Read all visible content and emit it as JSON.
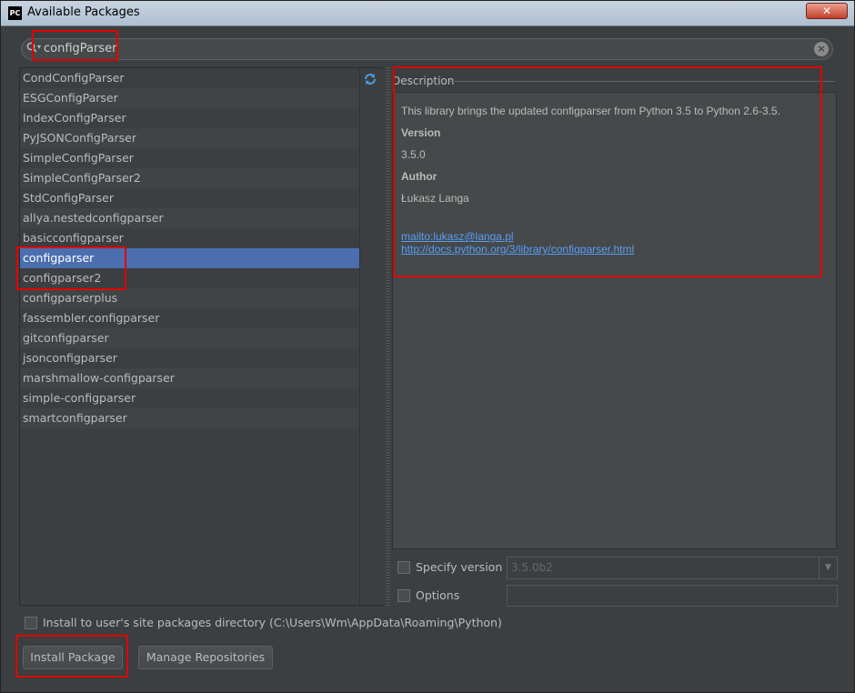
{
  "window": {
    "title": "Available Packages",
    "app_icon_text": "PC",
    "close_glyph": "✕"
  },
  "search": {
    "value": "configParser",
    "icon": "search-icon",
    "clear_glyph": "×"
  },
  "packages": [
    "CondConfigParser",
    "ESGConfigParser",
    "IndexConfigParser",
    "PyJSONConfigParser",
    "SimpleConfigParser",
    "SimpleConfigParser2",
    "StdConfigParser",
    "allya.nestedconfigparser",
    "basicconfigparser",
    "configparser",
    "configparser2",
    "configparserplus",
    "fassembler.configparser",
    "gitconfigparser",
    "jsonconfigparser",
    "marshmallow-configparser",
    "simple-configparser",
    "smartconfigparser"
  ],
  "selected_package": "configparser",
  "description": {
    "label": "Description",
    "summary": "This library brings the updated configparser from Python 3.5 to Python 2.6-3.5.",
    "version_heading": "Version",
    "version": "3.5.0",
    "author_heading": "Author",
    "author": "Łukasz Langa",
    "links": [
      "mailto:lukasz@langa.pl",
      "http://docs.python.org/3/library/configparser.html"
    ]
  },
  "options": {
    "specify_version_label": "Specify version",
    "specify_version_value": "3.5.0b2",
    "options_label": "Options",
    "options_value": "",
    "install_user_site_label": "Install to user's site packages directory (C:\\Users\\Wm\\AppData\\Roaming\\Python)"
  },
  "buttons": {
    "install": "Install Package",
    "manage_repos": "Manage Repositories"
  },
  "colors": {
    "background": "#3c3f41",
    "selection": "#4b6eaf",
    "link": "#589df6",
    "annotation": "#e00000"
  }
}
